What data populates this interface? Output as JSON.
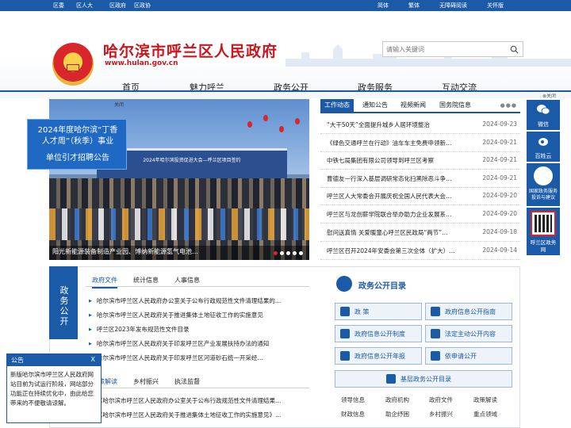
{
  "topbar": {
    "links": [
      "区委",
      "区人大",
      "区政府",
      "区政协"
    ],
    "right_links": [
      "简体",
      "繁体",
      "无障碍阅读",
      "关怀版"
    ]
  },
  "header": {
    "title": "哈尔滨市呼兰区人民政府",
    "url": "www.hulan.gov.cn",
    "search_placeholder": "请输入关键词"
  },
  "nav": {
    "items": [
      "首页",
      "魅力呼兰",
      "政务公开",
      "政务服务",
      "互动交流"
    ]
  },
  "slider": {
    "caption": "阳光新能源装备制造产业园、博纳新能源氢气电池…",
    "stage_text": "2024年哈尔滨投资促进大会—呼兰区项目签约",
    "close_label": "关闭"
  },
  "recruit": {
    "lines": [
      "2024年度哈尔滨“丁香",
      "人才周”（秋季）事业",
      "单位引才招聘公告"
    ]
  },
  "news": {
    "tabs": [
      "工作动态",
      "通知公告",
      "视频新闻",
      "国务院信息"
    ],
    "more": "●●●",
    "items": [
      {
        "title": "“大干50天”全面提升城乡人居环境整治",
        "date": "2024-09-23"
      },
      {
        "title": "《绿色交通呼兰在行动》油车车主免费申领新…",
        "date": "2024-09-21"
      },
      {
        "title": "中铁七局集团有限公司领导到呼兰区考察",
        "date": "2024-09-21"
      },
      {
        "title": "曹德友一行深入基层调研常态化扫黑除恶斗争…",
        "date": "2024-09-21"
      },
      {
        "title": "呼兰区人大常委会开展庆祝全国人民代表大会…",
        "date": "2024-09-20"
      },
      {
        "title": "呼兰区与龙创薪学院联合举办助力企业发展系…",
        "date": "2024-09-20"
      },
      {
        "title": "慰问送真情 关爱暖童心呼兰区民政局“两节”…",
        "date": "2024-09-18"
      },
      {
        "title": "呼兰区召开2024年安委会第三次全体（扩大）…",
        "date": "2024-09-14"
      }
    ]
  },
  "float": {
    "close": "关闭",
    "items": [
      "微信",
      "百姓云",
      "国家政务服务投诉与建议",
      "呼兰区政务网"
    ]
  },
  "vtab": {
    "chars": [
      "政",
      "务",
      "公",
      "开"
    ]
  },
  "pub": {
    "tabs": [
      "政府文件",
      "统计信息",
      "人事信息"
    ],
    "items": [
      "哈尔滨市呼兰区人民政府办公室关于公布行政规范性文件清理结果的…",
      "哈尔滨市呼兰区人民政府关于推进集体土地征收工作的实施意见",
      "呼兰区2023年发布规范性文件目录",
      "哈尔滨市呼兰区人民政府关于印发呼兰区产业发展扶持办法的通知",
      "哈尔滨市呼兰区人民政府关于印发呼兰区河道砂石统一开采经…"
    ]
  },
  "pub2": {
    "tabs": [
      "政策解读",
      "乡村振兴",
      "执法监督"
    ],
    "items": [
      "《哈尔滨市呼兰区人民政府办公室关于公布行政规范性文件清理结果…",
      "《哈尔滨市呼兰区人民政府关于推进集体土地征收工作的实施意见》…"
    ]
  },
  "directory": {
    "title": "政务公开目录",
    "buttons": [
      "政 策",
      "政府信息公开指南",
      "政府信息公开制度",
      "法定主动公开内容",
      "政府信息公开年报",
      "依申请公开",
      "基层政务公开目录"
    ],
    "categories": [
      "领导信息",
      "政府机构",
      "政府文件",
      "政策解读",
      "财政信息",
      "助企纾困",
      "乡村振兴",
      "重点领域"
    ]
  },
  "notice": {
    "title": "公告",
    "close": "X",
    "body": "新版哈尔滨市呼兰区人民政府网站目前为试运行阶段，网站部分功能正在持续优化中，由此给您带来的不便敬请谅解。"
  },
  "colors": {
    "primary": "#1a5aa7",
    "brand_red": "#c8161d"
  }
}
